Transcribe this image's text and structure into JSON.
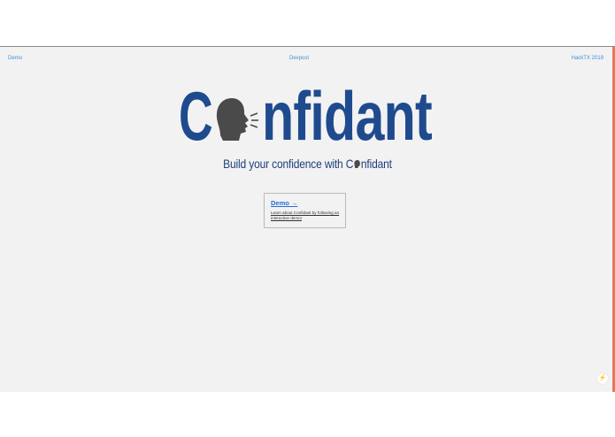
{
  "nav": {
    "demo": "Demo",
    "devpost": "Devpost",
    "hacktx": "HackTX 2019"
  },
  "logo": {
    "before": "C",
    "after": "nfidant",
    "icon": "speaking-head-icon"
  },
  "tagline": {
    "before": "Build your confidence with C",
    "after": "nfidant"
  },
  "card": {
    "title": "Demo →",
    "description": "Learn about Confidant by following an interactive demo!"
  },
  "corner_button": {
    "glyph": "⚡",
    "icon": "lightning-icon"
  },
  "colors": {
    "brand_blue": "#1f4b8e",
    "head_gray": "#4a4a4a",
    "link_blue": "#3f8fd6",
    "accent_orange": "#e37b52"
  }
}
